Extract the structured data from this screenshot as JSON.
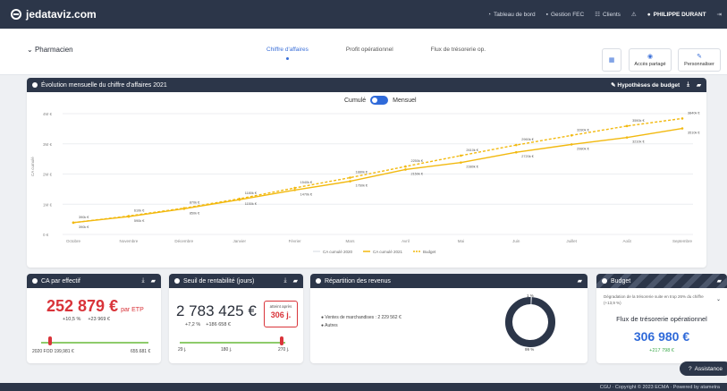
{
  "app": {
    "brand": "jedataviz.com"
  },
  "topnav": {
    "dashboard": "Tableau de bord",
    "fec": "Gestion FEC",
    "clients": "Clients",
    "user": "PHILIPPE DURANT"
  },
  "subheader": {
    "company": "Pharmacien",
    "tabs": [
      {
        "label": "Chiffre d'affaires"
      },
      {
        "label": "Profit opérationnel"
      },
      {
        "label": "Flux de trésorerie op."
      }
    ],
    "btn_access": "Accès partagé",
    "btn_customize": "Personnaliser"
  },
  "evolution": {
    "title": "Évolution mensuelle du chiffre d'affaires 2021",
    "hypotheses": "Hypothèses de budget",
    "toggle_left": "Cumulé",
    "toggle_right": "Mensuel"
  },
  "chart_data": {
    "type": "line",
    "categories": [
      "Octobre",
      "Novembre",
      "Décembre",
      "Janvier",
      "Février",
      "Mars",
      "Avril",
      "Mai",
      "Juin",
      "Juillet",
      "Août",
      "Septembre"
    ],
    "ylabel": "CA cumulé",
    "ytick_labels": [
      "0 €",
      "1M €",
      "2M €",
      "3M €",
      "4M €"
    ],
    "ylim": [
      0,
      4000000
    ],
    "grid": true,
    "legend_position": "bottom",
    "series": [
      {
        "name": "CA cumulé 2020",
        "color": "#e3e6ea",
        "values": []
      },
      {
        "name": "CA cumulé 2021",
        "color": "#f2b90f",
        "dashed": false,
        "values": [
          390000,
          590000,
          850000,
          1150000,
          1470000,
          1760000,
          2150000,
          2380000,
          2720000,
          2980000,
          3210000,
          3510000
        ],
        "labels": [
          "390k €",
          "590k €",
          "850k €",
          "1150k €",
          "1470k €",
          "1760k €",
          "2150k €",
          "2380k €",
          "2720k €",
          "2980k €",
          "3210k €",
          "3510k €"
        ]
      },
      {
        "name": "Budget",
        "color": "#f2b90f",
        "dashed": true,
        "values": [
          390000,
          610000,
          870000,
          1180000,
          1540000,
          1880000,
          2250000,
          2610000,
          2960000,
          3280000,
          3590000,
          3840000
        ],
        "labels": [
          "390k €",
          "610k €",
          "870k €",
          "1180k €",
          "1540k €",
          "1880k €",
          "2250k €",
          "2610k €",
          "2960k €",
          "3280k €",
          "3590k €",
          "3840k €"
        ]
      }
    ]
  },
  "ca_effectif": {
    "title": "CA par effectif",
    "value": "252 879 €",
    "unit": "par ETP",
    "delta_pct": "+10,5 %",
    "delta_abs": "+23 969 €",
    "min_label": "2020 FOD 199,981 €",
    "max_label": "655.681 €",
    "progress": 0.07
  },
  "seuil": {
    "title": "Seuil de rentabilité (jours)",
    "value": "2 783 425 €",
    "delta_pct": "+7,2 %",
    "delta_abs": "+186 658 €",
    "badge_label": "atteint après",
    "badge_value": "306 j.",
    "ticks": [
      "29 j.",
      "180 j.",
      "270 j."
    ],
    "progress": 0.98
  },
  "repartition": {
    "title": "Répartition des revenus",
    "legend": [
      {
        "label": "Ventes de marchandises : 2 229 562 €",
        "color": "#2c3649"
      },
      {
        "label": "Autres",
        "color": "#2c3649"
      }
    ],
    "donut_top": "1 %",
    "donut_bottom": "99 %",
    "share_main": 0.99
  },
  "budget": {
    "title": "Budget",
    "desc": "Dégradation de la trésorerie suite en trop 26% du chiffre (+13,9 %)",
    "label": "Flux de trésorerie opérationnel",
    "value": "306 980 €",
    "delta": "+217 798 €"
  },
  "assist": "Assistance",
  "footer": "CGU · Copyright © 2023 ECMA · Powered by atametra"
}
